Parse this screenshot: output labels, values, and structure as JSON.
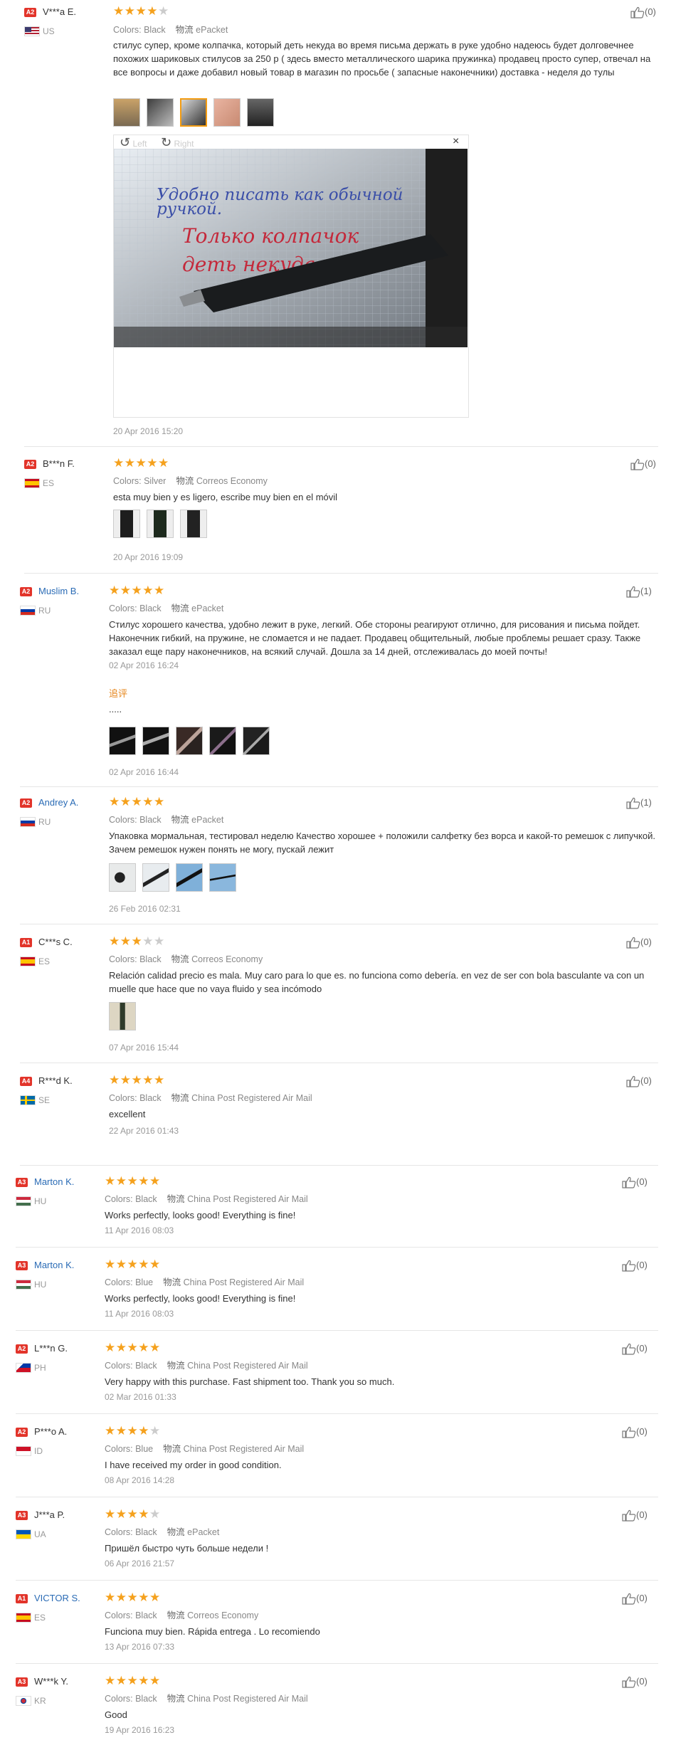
{
  "colors_label": "Colors:",
  "shipping_prefix": "物流",
  "additional_feedback_label": "追评",
  "viewer": {
    "left_label": "Left",
    "right_label": "Right",
    "close_label": "×"
  },
  "photo_text": {
    "line1": "Удобно писать как обычной",
    "line2": "ручкой.",
    "line3": "Только колпачок",
    "line4": "деть некуда"
  },
  "reviews": [
    {
      "badge": "A2",
      "name": "V***a E.",
      "country": "US",
      "rating": 4,
      "color": "Black",
      "shipping": "ePacket",
      "text": "стилус супер, кроме колпачка, который деть некуда во время письма держать в руке удобно надеюсь будет долговечнее похожих шариковых стилусов за 250 р ( здесь вместо металлического шарика пружинка) продавец просто супер, отвечал на все вопросы и даже добавил новый товар в магазин по просьбе ( запасные наконечники) доставка - неделя до тулы",
      "date": "20 Apr 2016 15:20",
      "likes": "(0)"
    },
    {
      "badge": "A2",
      "name": "B***n F.",
      "country": "ES",
      "rating": 5,
      "color": "Silver",
      "shipping": "Correos Economy",
      "text": "esta muy bien y es ligero, escribe muy bien en el móvil",
      "date": "20 Apr 2016 19:09",
      "likes": "(0)"
    },
    {
      "badge": "A2",
      "name": "Muslim B.",
      "country": "RU",
      "rating": 5,
      "color": "Black",
      "shipping": "ePacket",
      "text": "Стилус хорошего качества, удобно лежит в руке, легкий. Обе стороны реагируют отлично, для рисования и письма пойдет. Наконечник гибкий, на пружине, не сломается и не падает. Продавец общительный, любые проблемы решает сразу. Также заказал еще пару наконечников, на всякий случай. Дошла за 14 дней, отслеживалась до моей почты!",
      "date": "02 Apr 2016 16:24",
      "additional_text": ".....",
      "additional_date": "02 Apr 2016 16:44",
      "likes": "(1)"
    },
    {
      "badge": "A2",
      "name": "Andrey A.",
      "country": "RU",
      "rating": 5,
      "color": "Black",
      "shipping": "ePacket",
      "text": "Упаковка мормальная, тестировал неделю Качество хорошее + положили салфетку без ворса и какой-то ремешок с липучкой. Зачем ремешок нужен понять не могу, пускай лежит",
      "date": "26 Feb 2016 02:31",
      "likes": "(1)"
    },
    {
      "badge": "A1",
      "name": "C***s C.",
      "country": "ES",
      "rating": 3,
      "color": "Black",
      "shipping": "Correos Economy",
      "text": "Relación calidad precio es mala. Muy caro para lo que es. no funciona como debería. en vez de ser con bola basculante va con un muelle que hace que no vaya fluido y sea incómodo",
      "date": "07 Apr 2016 15:44",
      "likes": "(0)"
    },
    {
      "badge": "A4",
      "name": "R***d K.",
      "country": "SE",
      "rating": 5,
      "color": "Black",
      "shipping": "China Post Registered Air Mail",
      "text": "excellent",
      "date": "22 Apr 2016 01:43",
      "likes": "(0)"
    },
    {
      "badge": "A3",
      "name": "Marton K.",
      "country": "HU",
      "rating": 5,
      "color": "Black",
      "shipping": "China Post Registered Air Mail",
      "text": "Works perfectly, looks good! Everything is fine!",
      "date": "11 Apr 2016 08:03",
      "likes": "(0)"
    },
    {
      "badge": "A3",
      "name": "Marton K.",
      "country": "HU",
      "rating": 5,
      "color": "Blue",
      "shipping": "China Post Registered Air Mail",
      "text": "Works perfectly, looks good! Everything is fine!",
      "date": "11 Apr 2016 08:03",
      "likes": "(0)"
    },
    {
      "badge": "A2",
      "name": "L***n G.",
      "country": "PH",
      "rating": 5,
      "color": "Black",
      "shipping": "China Post Registered Air Mail",
      "text": "Very happy with this purchase. Fast shipment too. Thank you so much.",
      "date": "02 Mar 2016 01:33",
      "likes": "(0)"
    },
    {
      "badge": "A2",
      "name": "P***o A.",
      "country": "ID",
      "rating": 4,
      "color": "Blue",
      "shipping": "China Post Registered Air Mail",
      "text": "I have received my order in good condition.",
      "date": "08 Apr 2016 14:28",
      "likes": "(0)"
    },
    {
      "badge": "A3",
      "name": "J***a P.",
      "country": "UA",
      "rating": 4,
      "color": "Black",
      "shipping": "ePacket",
      "text": "Пришёл быстро чуть больше недели !",
      "date": "06 Apr 2016 21:57",
      "likes": "(0)"
    },
    {
      "badge": "A1",
      "name": "VICTOR S.",
      "country": "ES",
      "rating": 5,
      "color": "Black",
      "shipping": "Correos Economy",
      "text": "Funciona muy bien. Rápida entrega . Lo recomiendo",
      "date": "13 Apr 2016 07:33",
      "likes": "(0)"
    },
    {
      "badge": "A3",
      "name": "W***k Y.",
      "country": "KR",
      "rating": 5,
      "color": "Black",
      "shipping": "China Post Registered Air Mail",
      "text": "Good",
      "date": "19 Apr 2016 16:23",
      "likes": "(0)"
    }
  ],
  "theme": {
    "star_color": "#f5a11d",
    "badge_color": "#e2342a",
    "link_color": "#2a6bb5",
    "accent_orange": "#e6851a"
  }
}
